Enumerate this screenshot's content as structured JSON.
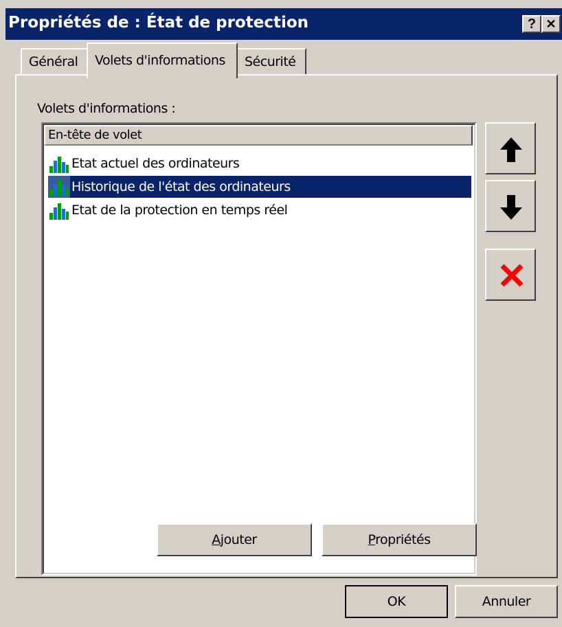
{
  "window": {
    "title": "Propriétés de : État de protection",
    "help_label": "?",
    "close_label": "✕"
  },
  "tabs": [
    {
      "label": "Général"
    },
    {
      "label": "Volets d'informations"
    },
    {
      "label": "Sécurité"
    }
  ],
  "active_tab": "Volets d'informations",
  "panel": {
    "section_label": "Volets d'informations :",
    "column_header": "En-tête de volet",
    "items": [
      {
        "label": "Etat actuel des ordinateurs",
        "icon": "bar-chart-icon",
        "selected": false
      },
      {
        "label": "Historique de l'état des ordinateurs",
        "icon": "bar-chart-icon",
        "selected": true
      },
      {
        "label": "Etat de la protection en temps réel",
        "icon": "bar-chart-icon",
        "selected": false
      }
    ],
    "side_buttons": [
      {
        "icon": "arrow-up-icon"
      },
      {
        "icon": "arrow-down-icon"
      },
      {
        "icon": "delete-x-icon",
        "color": "#ff0000"
      }
    ],
    "add_button": {
      "accel": "A",
      "rest": "jouter"
    },
    "properties_button": {
      "accel": "P",
      "rest": "ropriétés"
    }
  },
  "footer": {
    "ok_label": "OK",
    "cancel_label": "Annuler"
  },
  "colors": {
    "titlebar": "#0a246a",
    "face": "#d4d0c8",
    "selection": "#0a246a",
    "chart_green": "#00a000",
    "chart_blue": "#1c6ed8"
  }
}
